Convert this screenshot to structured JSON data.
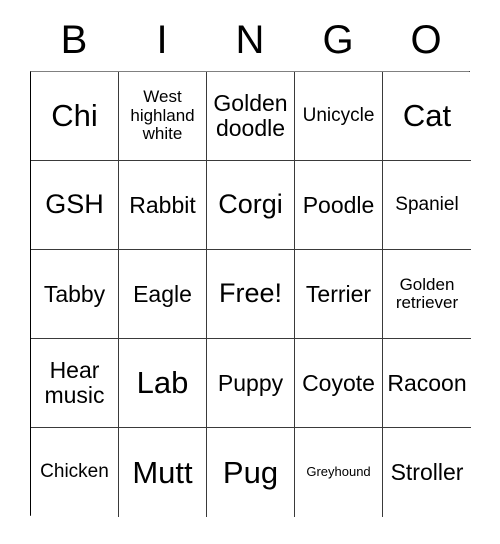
{
  "card": {
    "headers": [
      "B",
      "I",
      "N",
      "G",
      "O"
    ],
    "rows": [
      [
        {
          "text": "Chi",
          "size": "xl"
        },
        {
          "text": "West highland white",
          "size": "xs"
        },
        {
          "text": "Golden doodle",
          "size": "md"
        },
        {
          "text": "Unicycle",
          "size": "sm"
        },
        {
          "text": "Cat",
          "size": "xl"
        }
      ],
      [
        {
          "text": "GSH",
          "size": "lg"
        },
        {
          "text": "Rabbit",
          "size": "md"
        },
        {
          "text": "Corgi",
          "size": "lg"
        },
        {
          "text": "Poodle",
          "size": "md"
        },
        {
          "text": "Spaniel",
          "size": "sm"
        }
      ],
      [
        {
          "text": "Tabby",
          "size": "md"
        },
        {
          "text": "Eagle",
          "size": "md"
        },
        {
          "text": "Free!",
          "size": "lg"
        },
        {
          "text": "Terrier",
          "size": "md"
        },
        {
          "text": "Golden retriever",
          "size": "xs"
        }
      ],
      [
        {
          "text": "Hear music",
          "size": "md"
        },
        {
          "text": "Lab",
          "size": "xl"
        },
        {
          "text": "Puppy",
          "size": "md"
        },
        {
          "text": "Coyote",
          "size": "md"
        },
        {
          "text": "Racoon",
          "size": "md"
        }
      ],
      [
        {
          "text": "Chicken",
          "size": "sm"
        },
        {
          "text": "Mutt",
          "size": "xl"
        },
        {
          "text": "Pug",
          "size": "xl"
        },
        {
          "text": "Greyhound",
          "size": "xxs"
        },
        {
          "text": "Stroller",
          "size": "md"
        }
      ]
    ],
    "colors": {
      "background": "#ffffff",
      "text": "#000000",
      "grid_line": "#3a3a3a",
      "outer_border": "#000000"
    }
  }
}
